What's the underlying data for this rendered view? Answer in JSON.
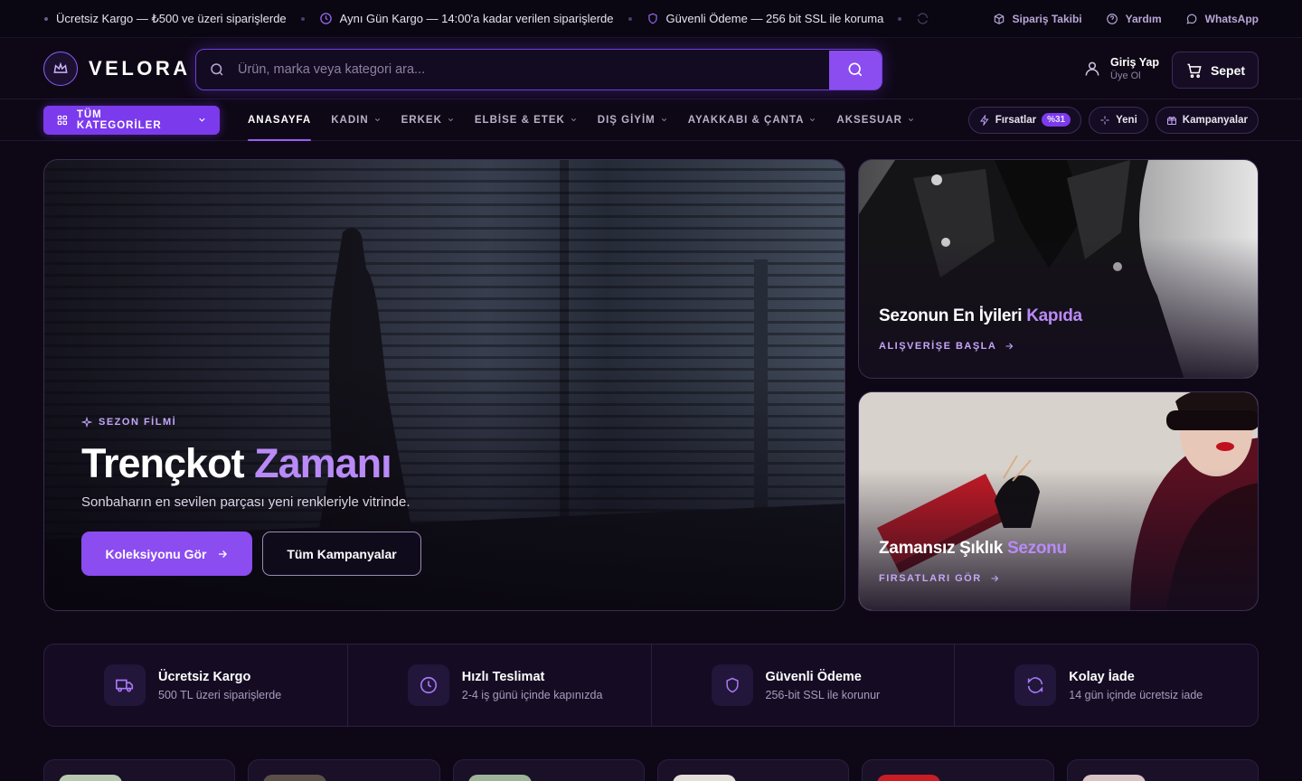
{
  "topbar": {
    "items": [
      {
        "icon": "truck-icon",
        "text": "Ücretsiz Kargo — ₺500 ve üzeri siparişlerde"
      },
      {
        "icon": "clock-icon",
        "text": "Aynı Gün Kargo — 14:00'a kadar verilen siparişlerde"
      },
      {
        "icon": "shield-icon",
        "text": "Güvenli Ödeme — 256 bit SSL ile koruma"
      }
    ],
    "links": {
      "order_tracking": "Sipariş Takibi",
      "help": "Yardım",
      "whatsapp": "WhatsApp"
    }
  },
  "header": {
    "brand": "VELORA",
    "search_placeholder": "Ürün, marka veya kategori ara...",
    "account_title": "Giriş Yap",
    "account_sub": "Üye Ol",
    "cart_label": "Sepet"
  },
  "nav": {
    "all_categories": "TÜM KATEGORİLER",
    "links": [
      {
        "label": "ANASAYFA",
        "active": true,
        "dropdown": false
      },
      {
        "label": "KADIN",
        "dropdown": true
      },
      {
        "label": "ERKEK",
        "dropdown": true
      },
      {
        "label": "ELBİSE & ETEK",
        "dropdown": true
      },
      {
        "label": "DIŞ GİYİM",
        "dropdown": true
      },
      {
        "label": "AYAKKABI & ÇANTA",
        "dropdown": true
      },
      {
        "label": "AKSESUAR",
        "dropdown": true
      }
    ],
    "pills": {
      "deals": "Fırsatlar",
      "deals_badge": "%31",
      "new": "Yeni",
      "campaigns": "Kampanyalar"
    }
  },
  "hero": {
    "eyebrow": "SEZON FİLMİ",
    "title_main": "Trençkot",
    "title_accent": "Zamanı",
    "subtitle": "Sonbaharın en sevilen parçası yeni renkleriyle vitrinde.",
    "primary_cta": "Koleksiyonu Gör",
    "secondary_cta": "Tüm Kampanyalar"
  },
  "side_cards": [
    {
      "title_main": "Sezonun En İyileri",
      "title_accent": "Kapıda",
      "cta": "ALIŞVERİŞE BAŞLA"
    },
    {
      "title_main": "Zamansız Şıklık",
      "title_accent": "Sezonu",
      "cta": "FIRSATLARI GÖR"
    }
  ],
  "features": [
    {
      "icon": "truck-icon",
      "title": "Ücretsiz Kargo",
      "subtitle": "500 TL üzeri siparişlerde"
    },
    {
      "icon": "clock-icon",
      "title": "Hızlı Teslimat",
      "subtitle": "2-4 iş günü içinde kapınızda"
    },
    {
      "icon": "shield-icon",
      "title": "Güvenli Ödeme",
      "subtitle": "256-bit SSL ile korunur"
    },
    {
      "icon": "refresh-icon",
      "title": "Kolay İade",
      "subtitle": "14 gün içinde ücretsiz iade"
    }
  ],
  "colors": {
    "accent": "#8b4cf0",
    "accent_light": "#b98af7",
    "background": "#0e0816"
  }
}
